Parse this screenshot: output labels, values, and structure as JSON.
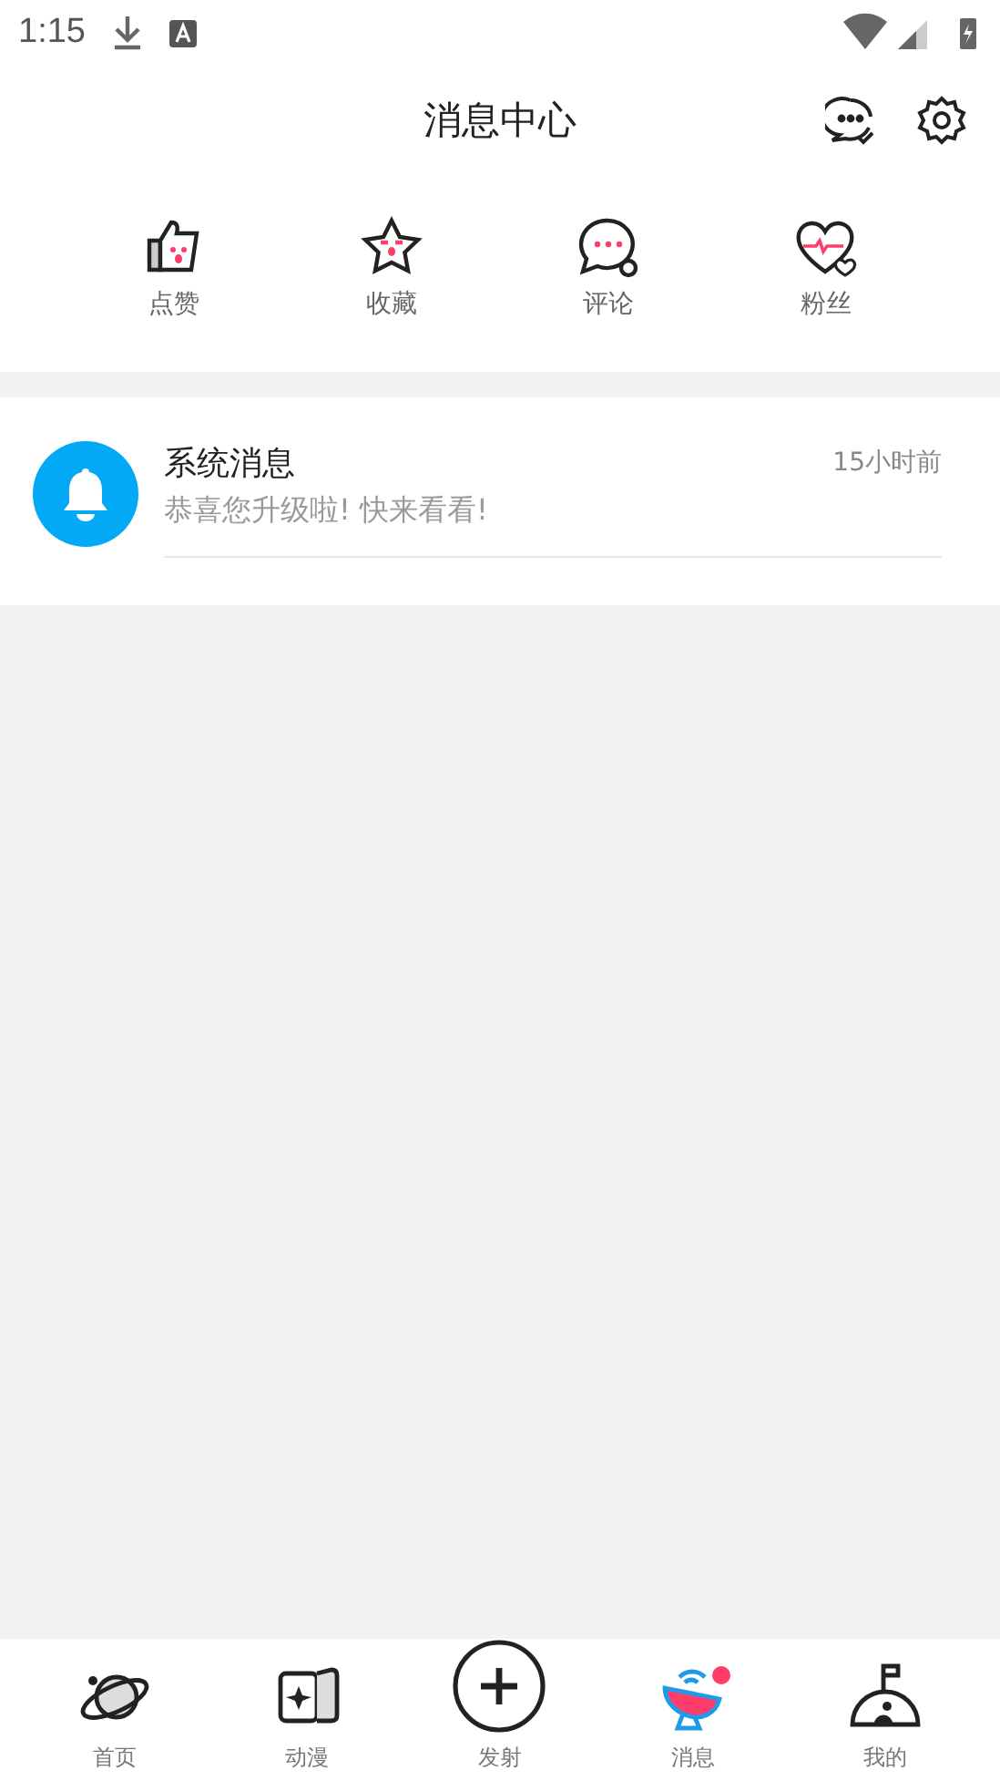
{
  "status_bar": {
    "time": "1:15"
  },
  "header": {
    "title": "消息中心"
  },
  "shortcuts": [
    {
      "kind": "like",
      "label": "点赞"
    },
    {
      "kind": "favorite",
      "label": "收藏"
    },
    {
      "kind": "comment",
      "label": "评论"
    },
    {
      "kind": "fans",
      "label": "粉丝"
    }
  ],
  "messages": [
    {
      "title": "系统消息",
      "preview": "恭喜您升级啦! 快来看看!",
      "time": "15小时前"
    }
  ],
  "nav": [
    {
      "kind": "planet",
      "label": "首页",
      "dot": false
    },
    {
      "kind": "book",
      "label": "动漫",
      "dot": false
    },
    {
      "kind": "plus",
      "label": "发射",
      "dot": false
    },
    {
      "kind": "dish",
      "label": "消息",
      "dot": true
    },
    {
      "kind": "moon",
      "label": "我的",
      "dot": false
    }
  ]
}
